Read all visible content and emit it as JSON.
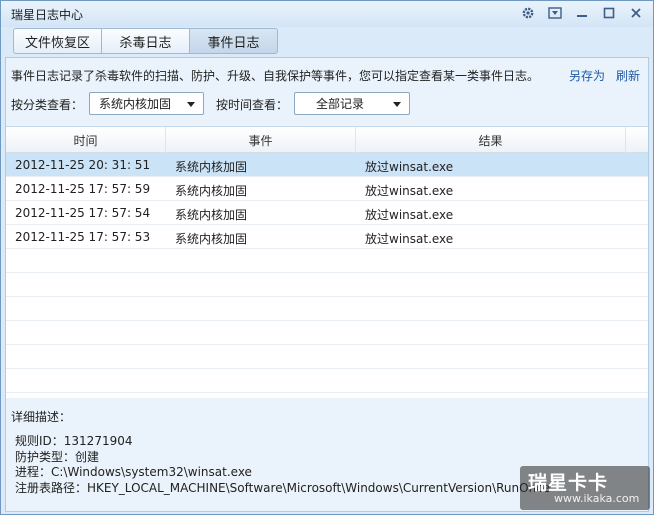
{
  "window": {
    "title": "瑞星日志中心"
  },
  "title_buttons": [
    "gear-icon",
    "menu-icon",
    "minimize-icon",
    "maximize-icon",
    "close-icon"
  ],
  "tabs": [
    {
      "label": "文件恢复区"
    },
    {
      "label": "杀毒日志"
    },
    {
      "label": "事件日志"
    }
  ],
  "info": {
    "text": "事件日志记录了杀毒软件的扫描、防护、升级、自我保护等事件，您可以指定查看某一类事件日志。",
    "save_as": "另存为",
    "refresh": "刷新"
  },
  "filters": {
    "category_label": "按分类查看：",
    "category_value": "系统内核加固",
    "time_label": "按时间查看：",
    "time_value": "全部记录"
  },
  "table": {
    "headers": [
      "时间",
      "事件",
      "结果"
    ],
    "rows": [
      [
        "2012-11-25 20: 31: 51",
        "系统内核加固",
        "放过winsat.exe"
      ],
      [
        "2012-11-25 17: 57: 59",
        "系统内核加固",
        "放过winsat.exe"
      ],
      [
        "2012-11-25 17: 57: 54",
        "系统内核加固",
        "放过winsat.exe"
      ],
      [
        "2012-11-25 17: 57: 53",
        "系统内核加固",
        "放过winsat.exe"
      ]
    ]
  },
  "detail": {
    "title": "详细描述：",
    "lines": [
      "规则ID：131271904",
      "防护类型：创建",
      "进程：C:\\Windows\\system32\\winsat.exe",
      "注册表路径：HKEY_LOCAL_MACHINE\\Software\\Microsoft\\Windows\\CurrentVersion\\RunOnce"
    ]
  },
  "watermark": {
    "logo": "瑞星卡卡",
    "url": "www.ikaka.com"
  },
  "colors": {
    "accent": "#1f5aa6",
    "selected_row": "#cbe3f7",
    "window_bg": "#dbeaf8"
  }
}
